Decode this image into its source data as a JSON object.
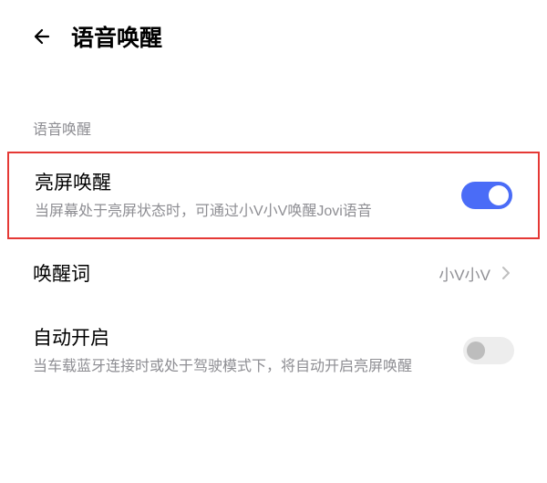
{
  "header": {
    "title": "语音唤醒"
  },
  "section": {
    "label": "语音唤醒"
  },
  "settings": {
    "bright_screen": {
      "title": "亮屏唤醒",
      "desc": "当屏幕处于亮屏状态时，可通过小V小V唤醒Jovi语音",
      "on": true
    },
    "wake_word": {
      "title": "唤醒词",
      "value": "小V小V"
    },
    "auto_open": {
      "title": "自动开启",
      "desc": "当车载蓝牙连接时或处于驾驶模式下，将自动开启亮屏唤醒",
      "on": false
    }
  }
}
